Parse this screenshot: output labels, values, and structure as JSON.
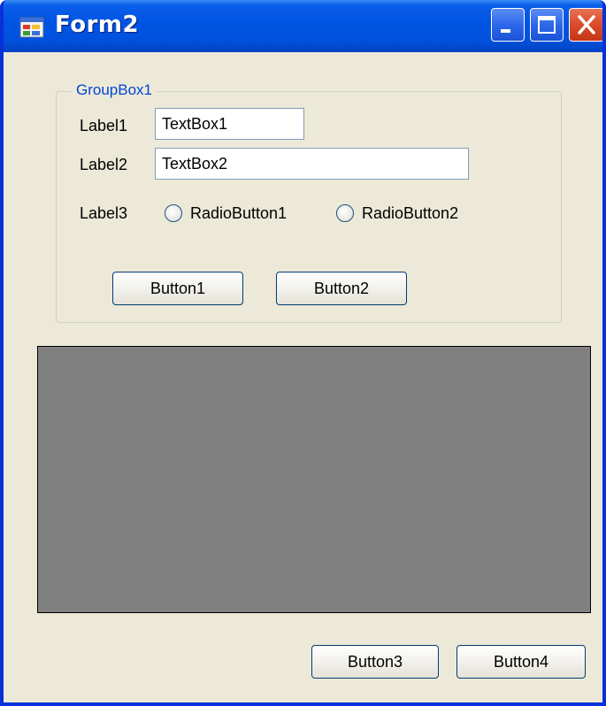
{
  "window": {
    "title": "Form2"
  },
  "groupbox": {
    "title": "GroupBox1",
    "label1": "Label1",
    "textbox1": "TextBox1",
    "label2": "Label2",
    "textbox2": "TextBox2",
    "label3": "Label3",
    "radio1": "RadioButton1",
    "radio2": "RadioButton2",
    "button1": "Button1",
    "button2": "Button2"
  },
  "footer": {
    "button3": "Button3",
    "button4": "Button4"
  },
  "colors": {
    "titlebar": "#0054e3",
    "form_bg": "#ece9d8",
    "panel_bg": "#808080",
    "group_title": "#0046d5"
  },
  "icons": {
    "app": "form-icon",
    "minimize": "minimize-icon",
    "maximize": "maximize-icon",
    "close": "close-icon"
  }
}
